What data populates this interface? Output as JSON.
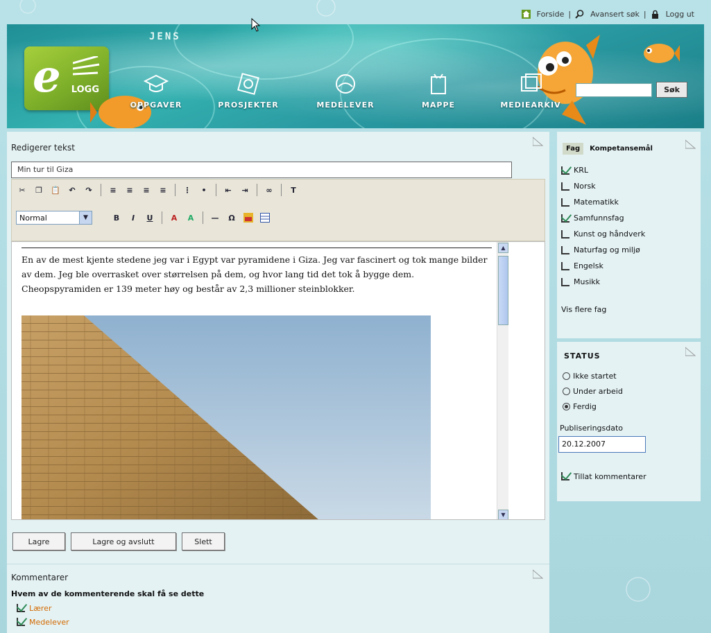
{
  "toplinks": {
    "home": "Forside",
    "search": "Avansert søk",
    "logout": "Logg ut"
  },
  "header": {
    "user": "JENS",
    "logo_letter": "e",
    "logo_sub": "LOGG",
    "nav": [
      "OPPGAVER",
      "PROSJEKTER",
      "MEDELEVER",
      "MAPPE",
      "MEDIEARKIV"
    ],
    "search_button": "Søk",
    "search_value": ""
  },
  "editor": {
    "heading": "Redigerer tekst",
    "title_value": "Min tur til Giza",
    "font_select": "Normal",
    "body_text": "En av de mest kjente stedene jeg var i Egypt var pyramidene i Giza. Jeg var fascinert og tok mange bilder av dem. Jeg ble overrasket over størrelsen på dem, og hvor lang tid det tok å bygge dem. Cheopspyramiden er 139 meter høy og består av 2,3 millioner steinblokker.",
    "buttons": {
      "save": "Lagre",
      "save_close": "Lagre og avslutt",
      "delete": "Slett"
    }
  },
  "comments": {
    "title": "Kommentarer",
    "subtitle": "Hvem av de kommenterende skal få se dette",
    "items": [
      "Lærer",
      "Medelever"
    ]
  },
  "subjects": {
    "tabs": [
      "Fag",
      "Kompetansemål"
    ],
    "items": [
      {
        "label": "KRL",
        "checked": true
      },
      {
        "label": "Norsk",
        "checked": false
      },
      {
        "label": "Matematikk",
        "checked": false
      },
      {
        "label": "Samfunnsfag",
        "checked": true
      },
      {
        "label": "Kunst og håndverk",
        "checked": false
      },
      {
        "label": "Naturfag og miljø",
        "checked": false
      },
      {
        "label": "Engelsk",
        "checked": false
      },
      {
        "label": "Musikk",
        "checked": false
      }
    ],
    "more": "Vis flere fag"
  },
  "status": {
    "title": "STATUS",
    "options": [
      {
        "label": "Ikke startet",
        "on": false
      },
      {
        "label": "Under arbeid",
        "on": false
      },
      {
        "label": "Ferdig",
        "on": true
      }
    ],
    "deadline_label": "Publiseringsdato",
    "deadline_value": "20.12.2007",
    "allow_comments": "Tillat kommentarer"
  }
}
